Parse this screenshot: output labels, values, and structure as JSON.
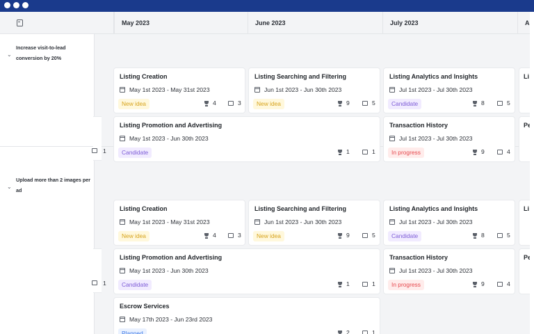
{
  "window": {
    "dots": 3
  },
  "header": {
    "months": [
      "May 2023",
      "June 2023",
      "July 2023",
      "A"
    ]
  },
  "groups": [
    {
      "label": "Increase visit-to-lead conversion by 20%"
    },
    {
      "label": "Upload more than 2 images per ad"
    }
  ],
  "cards": [
    {
      "title": "Listing Creation",
      "date": "May 1st 2023 - May 31st 2023",
      "status": "New idea",
      "votes": "4",
      "comments": "3"
    },
    {
      "title": "Listing Searching and Filtering",
      "date": "Jun 1st 2023 - Jun 30th 2023",
      "status": "New idea",
      "votes": "9",
      "comments": "5"
    },
    {
      "title": "Listing Analytics and Insights",
      "date": "Jul 1st 2023 - Jul 30th 2023",
      "status": "Candidate",
      "votes": "8",
      "comments": "5"
    },
    {
      "title": "Listing Promotion and Advertising",
      "date": "May 1st 2023 - Jun 30th 2023",
      "status": "Candidate",
      "votes": "1",
      "comments": "1"
    },
    {
      "title": "Transaction History",
      "date": "Jul 1st 2023 - Jul 30th 2023",
      "status": "In progress",
      "votes": "9",
      "comments": "4"
    },
    {
      "title": "Listing Creation",
      "date": "May 1st 2023 - May 31st 2023",
      "status": "New idea",
      "votes": "4",
      "comments": "3"
    },
    {
      "title": "Listing Searching and Filtering",
      "date": "Jun 1st 2023 - Jun 30th 2023",
      "status": "New idea",
      "votes": "9",
      "comments": "5"
    },
    {
      "title": "Listing Analytics and Insights",
      "date": "Jul 1st 2023 - Jul 30th 2023",
      "status": "Candidate",
      "votes": "8",
      "comments": "5"
    },
    {
      "title": "Listing Promotion and Advertising",
      "date": "May 1st 2023 - Jun 30th 2023",
      "status": "Candidate",
      "votes": "1",
      "comments": "1"
    },
    {
      "title": "Transaction History",
      "date": "Jul 1st 2023 - Jul 30th 2023",
      "status": "In progress",
      "votes": "9",
      "comments": "4"
    },
    {
      "title": "Escrow Services",
      "date": "May 17th 2023 - Jun 23rd 2023",
      "status": "Planned",
      "votes": "2",
      "comments": "1"
    }
  ],
  "edge_cards": [
    {
      "left_count": "1"
    },
    {
      "left_count": "1"
    }
  ],
  "right_cut": [
    "Li",
    "Pe",
    "Li",
    "Pe"
  ],
  "colors": {
    "titlebar": "#1a3a8c",
    "new_idea": "#d6a21a",
    "candidate": "#7b5ad6",
    "in_progress": "#e5484d",
    "planned": "#3b78e7"
  }
}
